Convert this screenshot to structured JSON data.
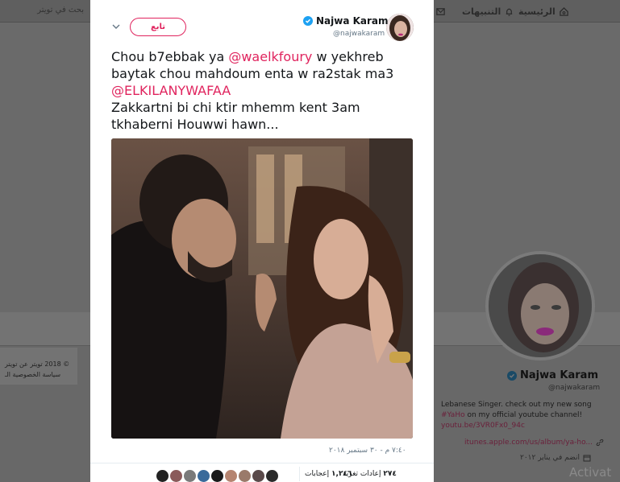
{
  "background": {
    "nav": {
      "home_label": "الرئيسية",
      "notifications_label": "التنبيهات",
      "search_placeholder": "بحث في تويتر"
    },
    "footer": {
      "line1": "© 2018 تويتر   عن تويتر",
      "line2": "سياسة الخصوصية   الـ"
    },
    "profile": {
      "name": "Najwa Karam",
      "handle": "@najwakaram",
      "bio_text": "Lebanese Singer. check out my new song",
      "bio_hashtag": "#YaHo",
      "bio_text2": " on my official youtube channel!",
      "bio_link": "youtu.be/3VR0Fx0_94c",
      "url": "itunes.apple.com/us/album/ya-ho...",
      "joined": "انضم في يناير ٢٠١٢"
    },
    "watermark": "Activat"
  },
  "tweet": {
    "author_name": "Najwa Karam",
    "author_handle": "@najwakaram",
    "follow_label": "تابع",
    "text": {
      "part1": "Chou b7ebbak ya ",
      "mention1": "@waelkfoury",
      "part2": " w yekhreb baytak chou mahdoum enta w ra2stak ma3 ",
      "mention2": "@ELKILANYWAFAA",
      "part3": "Zakkartni bi chi ktir mhemm kent 3am tkhaberni Houwwi hawn..."
    },
    "timestamp": "٧:٤٠ م - ٣٠ سبتمبر ٢٠١٨",
    "retweets": {
      "count": "٢٧٤",
      "label": "إعادات تغريد"
    },
    "likes": {
      "count": "١,٢٤٦",
      "label": "إعجابات"
    }
  },
  "colors": {
    "accent": "#e0245e",
    "verified": "#1da1f2",
    "overlay": "#686868"
  }
}
